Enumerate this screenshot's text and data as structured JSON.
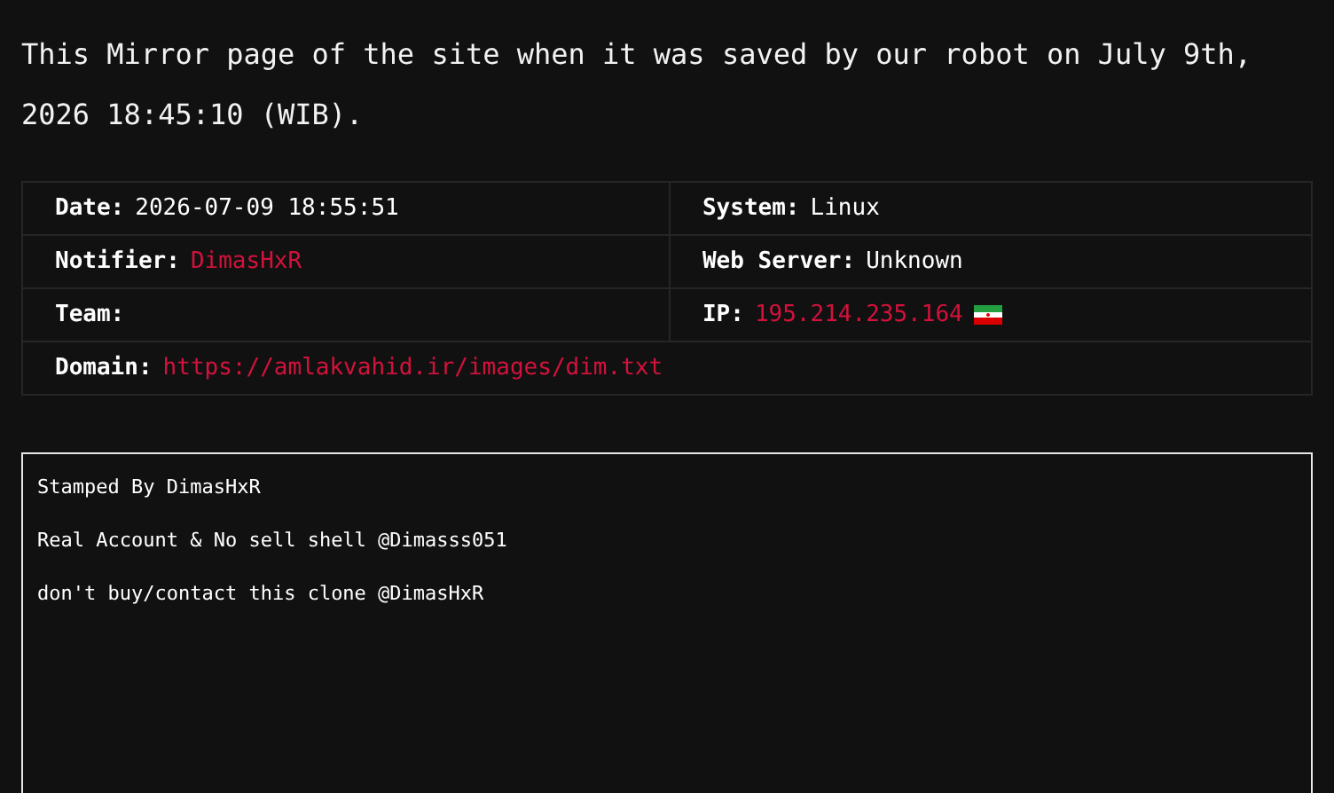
{
  "intro": "This Mirror page of the site when it was saved by our robot on July 9th, 2026 18:45:10 (WIB).",
  "details": [
    [
      {
        "label": "Date:",
        "value": "2026-07-09 18:55:51",
        "kind": "text"
      },
      {
        "label": "System:",
        "value": "Linux",
        "kind": "text"
      }
    ],
    [
      {
        "label": "Notifier:",
        "value": "DimasHxR",
        "kind": "link"
      },
      {
        "label": "Web Server:",
        "value": "Unknown",
        "kind": "text"
      }
    ],
    [
      {
        "label": "Team:"
      },
      {
        "label": "IP:",
        "value": "195.214.235.164",
        "kind": "ip"
      }
    ],
    [
      {
        "label": "Domain:",
        "value": "https://amlakvahid.ir/images/dim.txt",
        "kind": "link"
      }
    ]
  ],
  "mirror": {
    "lines": [
      "Stamped By DimasHxR",
      "Real Account & No sell shell @Dimasss051",
      "don't buy/contact this clone @DimasHxR"
    ]
  }
}
